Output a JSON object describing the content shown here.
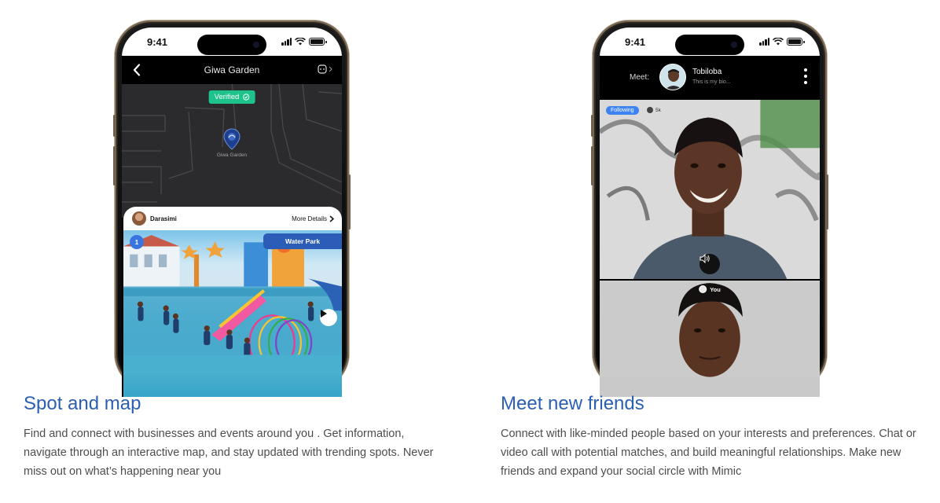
{
  "left_phone": {
    "status_time": "9:41",
    "title": "Giwa Garden",
    "verified_label": "Verified",
    "map_pin_label": "Giwa Garden",
    "card": {
      "user_name": "Darasimi",
      "more_details": "More Details",
      "badge_number": "1",
      "place_tag": "Water Park"
    }
  },
  "right_phone": {
    "status_time": "9:41",
    "meet_label": "Meet:",
    "profile_name": "Tobiloba",
    "profile_bio": "This is my bio...",
    "following_label": "Following",
    "followers_count": "5k",
    "self_label": "You"
  },
  "features": [
    {
      "title": "Spot and map",
      "description": "Find and connect with businesses and events around you . Get information, navigate through an interactive map, and stay updated with trending spots. Never miss out on what’s happening near you"
    },
    {
      "title": "Meet new friends",
      "description": "Connect with like-minded people based on your interests and preferences. Chat or video call with potential matches, and build meaningful relationships. Make new friends and expand your social circle with Mimic"
    }
  ],
  "colors": {
    "accent_blue": "#2b5fb4",
    "verified_green": "#1ec28b",
    "following_blue": "#3d83f1"
  }
}
